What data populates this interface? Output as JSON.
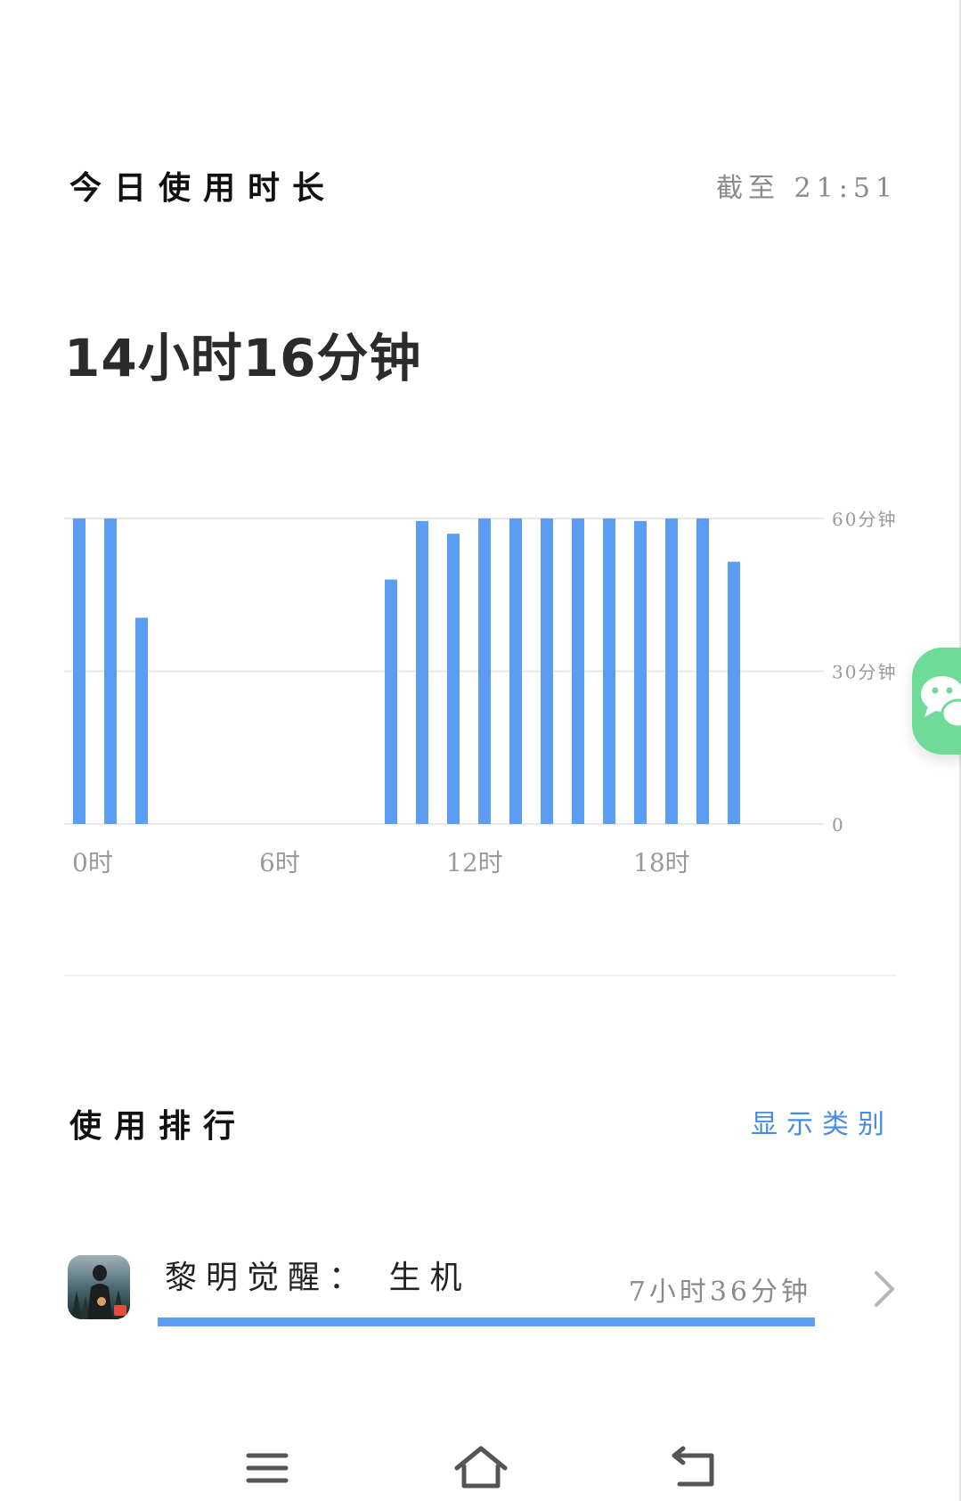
{
  "header": {
    "title": "今日使用时长",
    "cutoff": "截至 21:51"
  },
  "total": {
    "text": "14小时16分钟"
  },
  "chart_data": {
    "type": "bar",
    "x": [
      0,
      1,
      2,
      3,
      4,
      5,
      6,
      7,
      8,
      9,
      10,
      11,
      12,
      13,
      14,
      15,
      16,
      17,
      18,
      19,
      20,
      21
    ],
    "values": [
      60,
      60,
      40.5,
      0,
      0,
      0,
      0,
      0,
      0,
      0,
      48,
      59.5,
      57,
      60,
      60,
      60,
      60,
      60,
      59.5,
      60,
      60,
      51.5
    ],
    "xticks": [
      {
        "value": 0,
        "label": "0时"
      },
      {
        "value": 6,
        "label": "6时"
      },
      {
        "value": 12,
        "label": "12时"
      },
      {
        "value": 18,
        "label": "18时"
      }
    ],
    "yticks": [
      {
        "value": 60,
        "label": "60分钟"
      },
      {
        "value": 30,
        "label": "30分钟"
      },
      {
        "value": 0,
        "label": "0"
      }
    ],
    "ylim": [
      0,
      60
    ],
    "grid": true,
    "bar_color": "#5a9df2"
  },
  "ranking": {
    "title": "使用排行",
    "toggle_label": "显示类别",
    "items": [
      {
        "name": "黎明觉醒： 生机",
        "time": "7小时36分钟",
        "share": 1.0
      }
    ]
  },
  "colors": {
    "accent": "#4a8be0",
    "bar": "#5a9df2",
    "wechat": "#6edb98"
  },
  "icons": {
    "floating": "wechat-icon",
    "nav": [
      "menu-icon",
      "home-icon",
      "back-icon"
    ]
  }
}
